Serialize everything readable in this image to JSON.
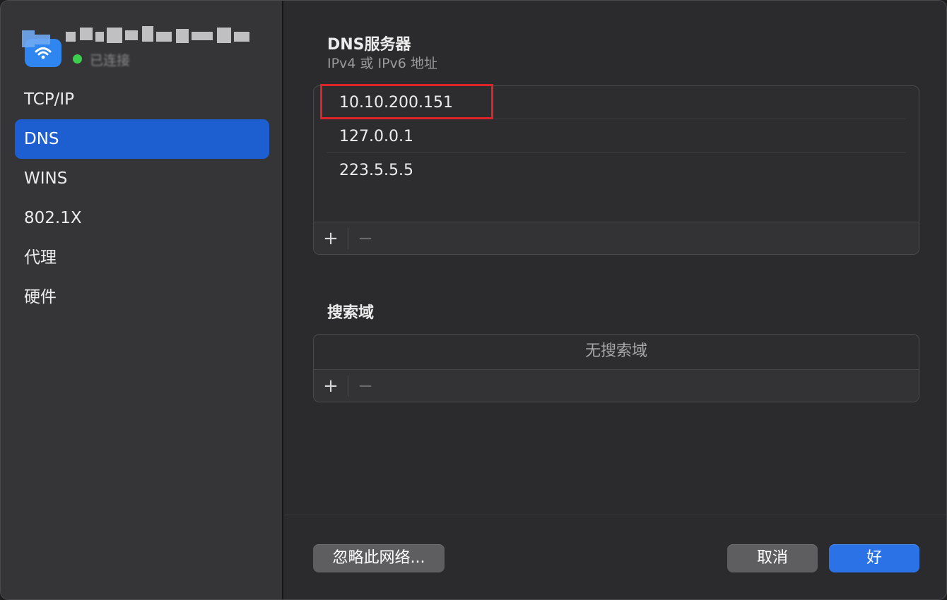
{
  "sidebar": {
    "connection_status": "已连接",
    "items": [
      {
        "label": "TCP/IP"
      },
      {
        "label": "DNS"
      },
      {
        "label": "WINS"
      },
      {
        "label": "802.1X"
      },
      {
        "label": "代理"
      },
      {
        "label": "硬件"
      }
    ],
    "selected": "DNS"
  },
  "dns": {
    "title": "DNS服务器",
    "subtitle": "IPv4 或 IPv6 地址",
    "servers": [
      "10.10.200.151",
      "127.0.0.1",
      "223.5.5.5"
    ],
    "add_symbol": "+",
    "remove_symbol": "−"
  },
  "search_domains": {
    "title": "搜索域",
    "empty_text": "无搜索域",
    "add_symbol": "+",
    "remove_symbol": "−"
  },
  "footer": {
    "forget_label": "忽略此网络...",
    "cancel_label": "取消",
    "ok_label": "好"
  },
  "colors": {
    "accent": "#2a72e6",
    "selected_nav": "#1d5fd0",
    "connected": "#3ccf4e",
    "highlight_box": "#e0232a"
  }
}
